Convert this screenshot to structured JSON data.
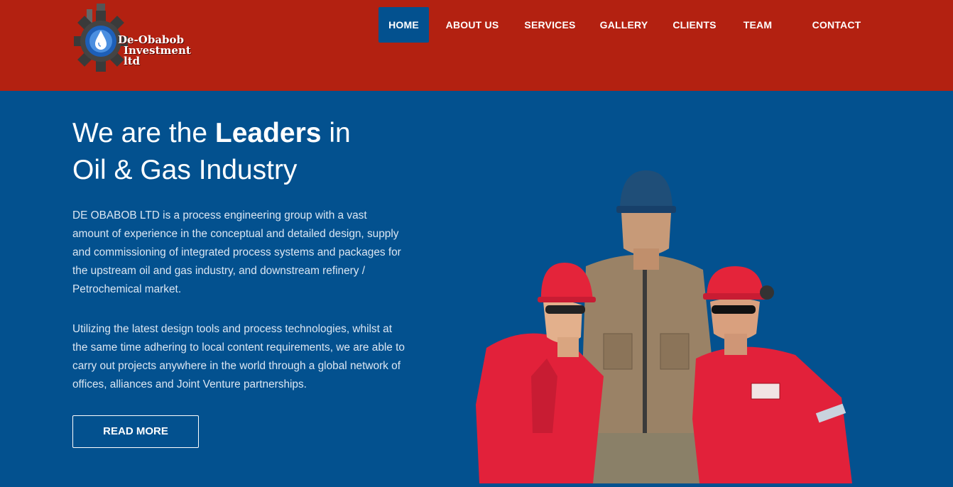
{
  "brand": {
    "logo_line1": "De-Obabob",
    "logo_line2": "Investment ltd",
    "header_color": "#b32111",
    "accent_color": "#03518f"
  },
  "nav": {
    "items": [
      {
        "label": "HOME",
        "active": true
      },
      {
        "label": "ABOUT US"
      },
      {
        "label": "SERVICES"
      },
      {
        "label": "GALLERY"
      },
      {
        "label": "CLIENTS"
      },
      {
        "label": "TEAM"
      },
      {
        "label": "CONTACT"
      }
    ]
  },
  "hero": {
    "title_part1": "We are the ",
    "title_bold": "Leaders",
    "title_part2": " in",
    "title_line2": "Oil & Gas Industry",
    "paragraph1": "DE OBABOB LTD is a process engineering group with a vast amount of experience in the conceptual and detailed design, supply and commissioning of integrated process systems and packages for the upstream oil and gas industry, and downstream refinery / Petrochemical market.",
    "paragraph2": "Utilizing the latest design tools and process technologies, whilst at the same time adhering to local content requirements, we are able to carry out projects anywhere in the world through a global network of offices, alliances and Joint Venture partnerships.",
    "button_label": "READ MORE",
    "image_icon": "workers-photo"
  }
}
